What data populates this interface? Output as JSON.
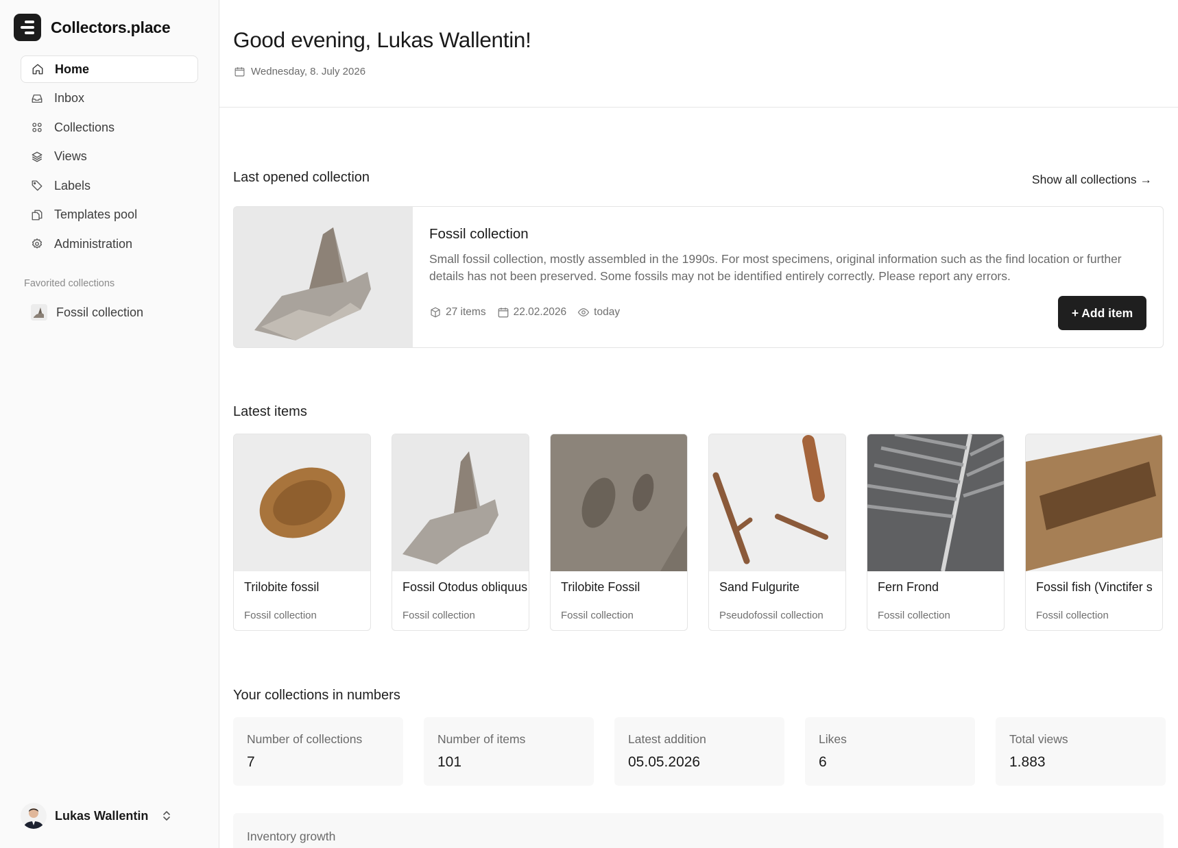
{
  "app": {
    "name": "Collectors.place"
  },
  "sidebar": {
    "items": [
      {
        "label": "Home",
        "icon": "home-icon",
        "active": true
      },
      {
        "label": "Inbox",
        "icon": "inbox-icon"
      },
      {
        "label": "Collections",
        "icon": "grid-icon"
      },
      {
        "label": "Views",
        "icon": "layers-icon"
      },
      {
        "label": "Labels",
        "icon": "tag-icon"
      },
      {
        "label": "Templates pool",
        "icon": "copy-icon"
      },
      {
        "label": "Administration",
        "icon": "gear-icon"
      }
    ],
    "favorites_heading": "Favorited collections",
    "favorites": [
      {
        "label": "Fossil collection"
      }
    ]
  },
  "user": {
    "name": "Lukas Wallentin"
  },
  "header": {
    "greeting": "Good evening, Lukas Wallentin!",
    "date": "Wednesday, 8. July 2026"
  },
  "last_opened": {
    "heading": "Last opened collection",
    "show_all": "Show all collections →",
    "title": "Fossil collection",
    "description": "Small fossil collection, mostly assembled in the 1990s. For most specimens, original information such as the find location or further details has not been preserved. Some fossils may not be identified entirely correctly. Please report any errors.",
    "items_count": "27 items",
    "date": "22.02.2026",
    "viewed": "today",
    "add_button": "+ Add item"
  },
  "latest": {
    "heading": "Latest items",
    "items": [
      {
        "name": "Trilobite fossil",
        "collection": "Fossil collection"
      },
      {
        "name": "Fossil Otodus obliquus",
        "collection": "Fossil collection"
      },
      {
        "name": "Trilobite Fossil",
        "collection": "Fossil collection"
      },
      {
        "name": "Sand Fulgurite",
        "collection": "Pseudofossil collection"
      },
      {
        "name": "Fern Frond",
        "collection": "Fossil collection"
      },
      {
        "name": "Fossil fish (Vinctifer s",
        "collection": "Fossil collection"
      }
    ]
  },
  "stats": {
    "heading": "Your collections in numbers",
    "cards": [
      {
        "label": "Number of collections",
        "value": "7"
      },
      {
        "label": "Number of items",
        "value": "101"
      },
      {
        "label": "Latest addition",
        "value": "05.05.2026"
      },
      {
        "label": "Likes",
        "value": "6"
      },
      {
        "label": "Total views",
        "value": "1.883"
      }
    ]
  },
  "growth": {
    "label": "Inventory growth"
  },
  "colors": {
    "accent": "#1f1f1f",
    "sidebar_bg": "#fafafa",
    "muted": "#6a6a6a"
  }
}
